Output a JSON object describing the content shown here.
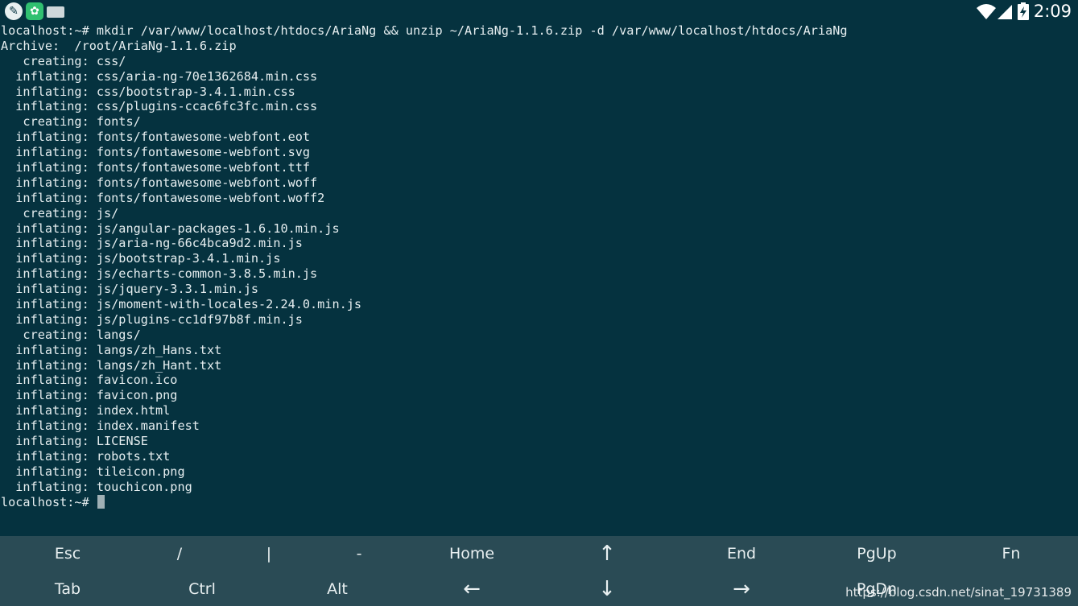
{
  "status_bar": {
    "time": "2:09",
    "left_icons": [
      "feather-icon",
      "android-icon",
      "keyboard-icon"
    ],
    "right_icons": [
      "wifi-icon",
      "cell-signal-icon",
      "battery-charging-icon"
    ]
  },
  "terminal": {
    "lines": [
      "localhost:~# mkdir /var/www/localhost/htdocs/AriaNg && unzip ~/AriaNg-1.1.6.zip -d /var/www/localhost/htdocs/AriaNg",
      "Archive:  /root/AriaNg-1.1.6.zip",
      "   creating: css/",
      "  inflating: css/aria-ng-70e1362684.min.css",
      "  inflating: css/bootstrap-3.4.1.min.css",
      "  inflating: css/plugins-ccac6fc3fc.min.css",
      "   creating: fonts/",
      "  inflating: fonts/fontawesome-webfont.eot",
      "  inflating: fonts/fontawesome-webfont.svg",
      "  inflating: fonts/fontawesome-webfont.ttf",
      "  inflating: fonts/fontawesome-webfont.woff",
      "  inflating: fonts/fontawesome-webfont.woff2",
      "   creating: js/",
      "  inflating: js/angular-packages-1.6.10.min.js",
      "  inflating: js/aria-ng-66c4bca9d2.min.js",
      "  inflating: js/bootstrap-3.4.1.min.js",
      "  inflating: js/echarts-common-3.8.5.min.js",
      "  inflating: js/jquery-3.3.1.min.js",
      "  inflating: js/moment-with-locales-2.24.0.min.js",
      "  inflating: js/plugins-cc1df97b8f.min.js",
      "   creating: langs/",
      "  inflating: langs/zh_Hans.txt",
      "  inflating: langs/zh_Hant.txt",
      "  inflating: favicon.ico",
      "  inflating: favicon.png",
      "  inflating: index.html",
      "  inflating: index.manifest",
      "  inflating: LICENSE",
      "  inflating: robots.txt",
      "  inflating: tileicon.png",
      "  inflating: touchicon.png"
    ],
    "prompt": "localhost:~# "
  },
  "extra_keys": {
    "row1": [
      "Esc",
      "/",
      "|",
      "-",
      "Home",
      "↑",
      "End",
      "PgUp",
      "Fn"
    ],
    "row2": [
      "Tab",
      "Ctrl",
      "Alt",
      "←",
      "↓",
      "→",
      "PgDn"
    ]
  },
  "watermark": "https://blog.csdn.net/sinat_19731389",
  "colors": {
    "terminal_bg": "#05323f",
    "terminal_fg": "#e6eef0",
    "keybar_bg": "#2a4b55",
    "cursor": "#9fb0b5"
  }
}
